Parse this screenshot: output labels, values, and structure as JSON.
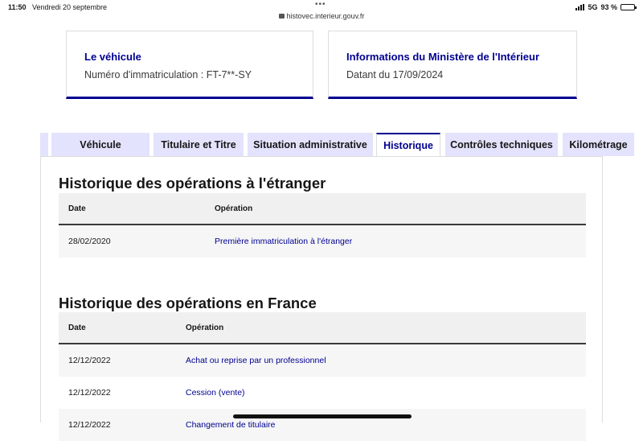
{
  "status": {
    "time": "11:50",
    "date": "Vendredi 20 septembre",
    "url": "histovec.interieur.gouv.fr",
    "network": "5G",
    "battery": "93 %",
    "battery_level": 0.93
  },
  "cards": {
    "vehicle": {
      "title": "Le véhicule",
      "text": "Numéro d'immatriculation : FT-7**-SY"
    },
    "ministry": {
      "title": "Informations du Ministère de l'Intérieur",
      "text": "Datant du 17/09/2024"
    }
  },
  "tabs": [
    {
      "label": "Véhicule"
    },
    {
      "label": "Titulaire et Titre"
    },
    {
      "label": "Situation administrative"
    },
    {
      "label": "Historique",
      "active": true
    },
    {
      "label": "Contrôles techniques"
    },
    {
      "label": "Kilométrage"
    }
  ],
  "history_abroad": {
    "title": "Historique des opérations à l'étranger",
    "headers": {
      "date": "Date",
      "operation": "Opération"
    },
    "rows": [
      {
        "date": "28/02/2020",
        "operation": "Première immatriculation à l'étranger"
      }
    ]
  },
  "history_france": {
    "title": "Historique des opérations en France",
    "headers": {
      "date": "Date",
      "operation": "Opération"
    },
    "rows": [
      {
        "date": "12/12/2022",
        "operation": "Achat ou reprise par un professionnel"
      },
      {
        "date": "12/12/2022",
        "operation": "Cession (vente)"
      },
      {
        "date": "12/12/2022",
        "operation": "Changement de titulaire"
      }
    ]
  },
  "colors": {
    "accent": "#000091",
    "tab_bg": "#e3e3fd"
  }
}
